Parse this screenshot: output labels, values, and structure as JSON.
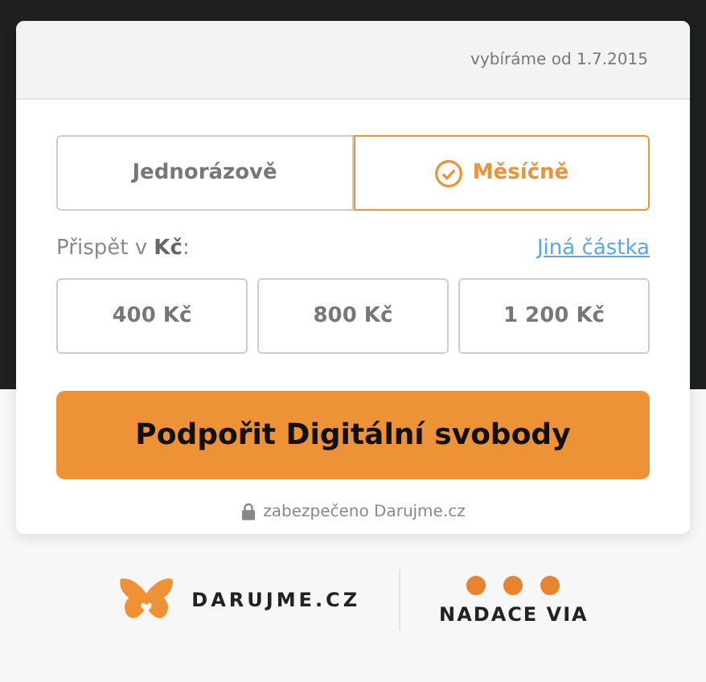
{
  "header": {
    "note": "vybíráme od 1.7.2015"
  },
  "frequency_tabs": [
    {
      "label": "Jednorázově",
      "selected": false
    },
    {
      "label": "Měsíčně",
      "selected": true
    }
  ],
  "amount_label": "Přispět v **Kč**:",
  "other_amount_link": "Jiná částka",
  "amounts": [
    {
      "label": "400 Kč",
      "selected": false
    },
    {
      "label": "800 Kč",
      "selected": false
    },
    {
      "label": "1 200 Kč",
      "selected": false
    }
  ],
  "submit_button": "Podpořit Digitální svobody",
  "secure_note": "zabezpečeno Darujme.cz",
  "footer": {
    "logos": [
      "DARUJME.CZ",
      "NADACE VIA"
    ]
  }
}
